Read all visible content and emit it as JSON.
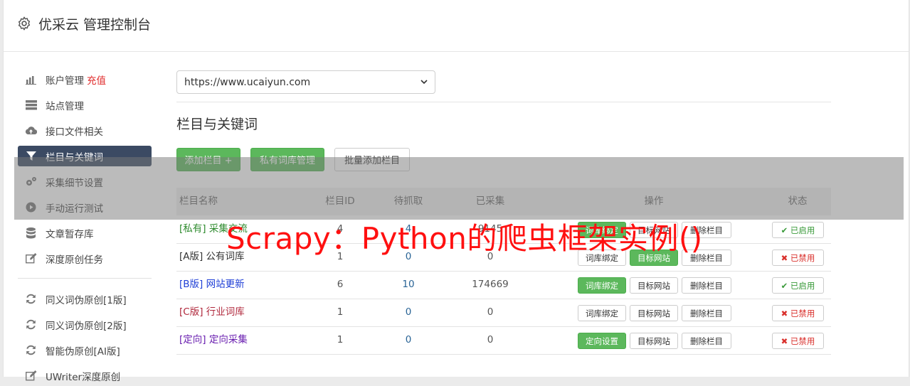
{
  "header": {
    "title": "优采云 管理控制台"
  },
  "sidebar": {
    "items": [
      {
        "label": "账户管理",
        "highlight": "充值",
        "icon": "bar-chart-icon"
      },
      {
        "label": "站点管理",
        "icon": "server-icon"
      },
      {
        "label": "接口文件相关",
        "icon": "cloud-upload-icon"
      },
      {
        "label": "栏目与关键词",
        "icon": "filter-icon",
        "active": true
      },
      {
        "label": "采集细节设置",
        "icon": "gears-icon"
      },
      {
        "label": "手动运行测试",
        "icon": "play-circle-icon"
      },
      {
        "label": "文章暂存库",
        "icon": "database-icon"
      },
      {
        "label": "深度原创任务",
        "icon": "edit-icon"
      },
      {
        "label": "同义词伪原创[1版]",
        "icon": "refresh-icon"
      },
      {
        "label": "同义词伪原创[2版]",
        "icon": "refresh-icon"
      },
      {
        "label": "智能伪原创[AI版]",
        "icon": "refresh-icon"
      },
      {
        "label": "UWriter深度原创",
        "icon": "edit-icon"
      }
    ]
  },
  "main": {
    "site_select": {
      "value": "https://www.ucaiyun.com"
    },
    "section_title": "栏目与关键词",
    "buttons": {
      "add_column": "添加栏目 +",
      "private_lexicon": "私有词库管理",
      "batch_add": "批量添加栏目"
    },
    "table": {
      "headers": [
        "栏目名称",
        "栏目ID",
        "待抓取",
        "已采集",
        "操作",
        "状态"
      ],
      "rows": [
        {
          "name": "[私有] 采集交流",
          "color": "#2e8b2e",
          "id": "4",
          "pending": "4",
          "collected": "9145",
          "op1": "词库绑定",
          "op1_green": true,
          "op2": "目标网站",
          "op2_green": false,
          "op3": "删除栏目",
          "state": "✔ 已启用",
          "state_on": true
        },
        {
          "name": "[A版] 公有词库",
          "color": "#333333",
          "id": "1",
          "pending": "0",
          "collected": "0",
          "op1": "词库绑定",
          "op1_green": false,
          "op2": "目标网站",
          "op2_green": true,
          "op3": "删除栏目",
          "state": "✖ 已禁用",
          "state_on": false
        },
        {
          "name": "[B版] 网站更新",
          "color": "#1f3fd6",
          "id": "6",
          "pending": "10",
          "collected": "174669",
          "op1": "词库绑定",
          "op1_green": true,
          "op2": "目标网站",
          "op2_green": false,
          "op3": "删除栏目",
          "state": "✔ 已启用",
          "state_on": true
        },
        {
          "name": "[C版] 行业词库",
          "color": "#b0283c",
          "id": "1",
          "pending": "0",
          "collected": "0",
          "op1": "词库绑定",
          "op1_green": false,
          "op2": "目标网站",
          "op2_green": false,
          "op3": "删除栏目",
          "state": "✖ 已禁用",
          "state_on": false
        },
        {
          "name": "[定向] 定向采集",
          "color": "#6a1fb0",
          "id": "1",
          "pending": "0",
          "collected": "0",
          "op1": "定向设置",
          "op1_green": true,
          "op2": "目标网站",
          "op2_green": false,
          "op3": "删除栏目",
          "state": "✖ 已禁用",
          "state_on": false
        }
      ]
    }
  },
  "overlay": {
    "watermark": "Scrapy：Python的爬虫框架实例()"
  }
}
